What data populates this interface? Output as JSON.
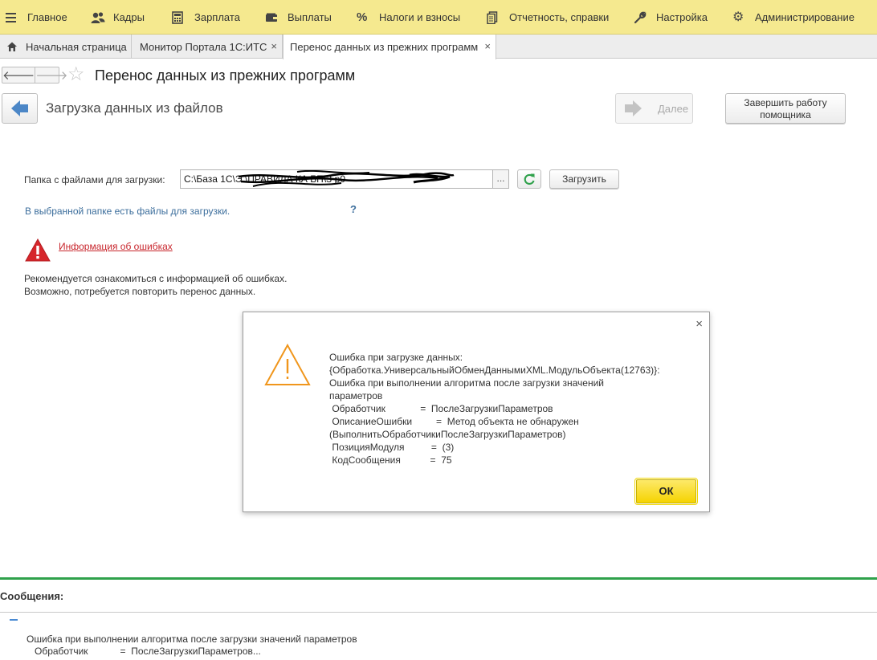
{
  "menu": {
    "items": [
      {
        "label": "Главное",
        "icon": "burger-icon"
      },
      {
        "label": "Кадры",
        "icon": "people-icon"
      },
      {
        "label": "Зарплата",
        "icon": "calculator-icon"
      },
      {
        "label": "Выплаты",
        "icon": "wallet-icon"
      },
      {
        "label": "Налоги и взносы",
        "icon": "percent-icon"
      },
      {
        "label": "Отчетность, справки",
        "icon": "document-icon"
      },
      {
        "label": "Настройка",
        "icon": "wrench-icon"
      },
      {
        "label": "Администрирование",
        "icon": "gear-icon"
      }
    ]
  },
  "tabs": [
    {
      "label": "Начальная страница",
      "icon": "home-icon"
    },
    {
      "label": "Монитор Портала 1С:ИТС",
      "close": "×"
    },
    {
      "label": "Перенос данных из прежних программ",
      "close": "×"
    }
  ],
  "page": {
    "title": "Перенос данных из прежних программ",
    "star": "☆",
    "back_arrow": "🡐",
    "forward_arrow": "🡒"
  },
  "wizard": {
    "step_title": "Загрузка данных из файлов",
    "next_label": "Далее",
    "finish_label_1": "Завершить работу",
    "finish_label_2": "помощника"
  },
  "folder": {
    "label": "Папка с файлами для загрузки:",
    "value": "C:\\База 1С\\Э           \\ПРАВИЛА КА БП\\З      р0",
    "ellipsis": "...",
    "load_label": "Загрузить"
  },
  "status": {
    "info": "В выбранной папке есть файлы для загрузки.",
    "help": "?",
    "error_link": "Информация об ошибках",
    "recommend_1": "Рекомендуется ознакомиться с информацией об ошибках.",
    "recommend_2": "Возможно, потребуется повторить перенос данных."
  },
  "dialog": {
    "close": "×",
    "message": "Ошибка при загрузке данных:\n{Обработка.УниверсальныйОбменДаннымиXML.МодульОбъекта(12763)}:\nОшибка при выполнении алгоритма после загрузки значений\nпараметров\n Обработчик             =  ПослеЗагрузкиПараметров\n ОписаниеОшибки         =  Метод объекта не обнаружен\n(ВыполнитьОбработчикиПослеЗагрузкиПараметров)\n ПозицияМодуля          =  (3)\n КодСообщения           =  75",
    "ok_label": "ОК"
  },
  "messages": {
    "title": "Сообщения:",
    "text": "Ошибка при выполнении алгоритма после загрузки значений параметров\n   Обработчик            =  ПослеЗагрузкиПараметров..."
  },
  "colors": {
    "menu_bg": "#f5e98f",
    "accent_green": "#2fa14b",
    "ok_yellow": "#f5d300",
    "error_red": "#c8252c",
    "link_blue": "#3c6e9c"
  }
}
